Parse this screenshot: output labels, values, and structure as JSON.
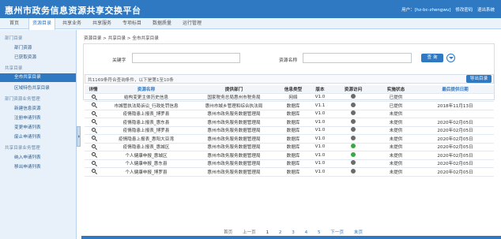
{
  "header": {
    "title": "惠州市政务信息资源共享交换平台",
    "user_label": "用户：[hz-bc-zhengwu]",
    "links": [
      "修改密码",
      "退出系统"
    ]
  },
  "nav": {
    "tabs": [
      "首页",
      "资源目录",
      "共享业务",
      "共享服务",
      "专项标目",
      "数据质量",
      "运行管理"
    ],
    "active_index": 1
  },
  "sidebar": {
    "groups": [
      {
        "title": "部门目录",
        "items": [
          "部门资源",
          "已获取资源"
        ]
      },
      {
        "title": "共享目录",
        "items": [
          "全市共享目录",
          "区域特色共享目录"
        ]
      },
      {
        "title": "部门资源业务管理",
        "items": [
          "新建信息资源",
          "注册申请列表",
          "变更申请列表",
          "废止申请列表"
        ]
      },
      {
        "title": "共享目录业务管理",
        "items": [
          "纳入申请列表",
          "移出申请列表"
        ]
      }
    ],
    "selected": "全市共享目录"
  },
  "content": {
    "breadcrumb": "资源目录 > 共享目录 > 全市共享目录",
    "search": {
      "keyword_label": "关键字",
      "keyword_value": "",
      "resource_label": "资源名称",
      "resource_value": "",
      "query_label": "查 询"
    },
    "count_text": "共1169条符合查询条件，以下是第1至10条",
    "export_label": "导出目录",
    "columns": [
      "详情",
      "资源名称",
      "提供部门",
      "信息类型",
      "版本",
      "资源访问",
      "实施状态",
      "最后提供日期"
    ],
    "rows": [
      {
        "name": "结构变更主体历史信息",
        "dept": "国家税务总局惠州市税务局",
        "type": "网络",
        "ver": "V1.0",
        "access": "gray",
        "status": "已提供",
        "date": ""
      },
      {
        "name": "市城管执法局诉讼_行政处罚信息",
        "dept": "惠州市城乡管理和综合执法局",
        "type": "数据库",
        "ver": "V1.1",
        "access": "gray",
        "status": "已提供",
        "date": "2018年11月13日"
      },
      {
        "name": "疫情隐患上报表_博罗县",
        "dept": "惠州市政务服务数据管理局",
        "type": "数据库",
        "ver": "V1.0",
        "access": "gray",
        "status": "未提供",
        "date": ""
      },
      {
        "name": "疫情隐患上报表_惠东县",
        "dept": "惠州市政务服务数据管理局",
        "type": "数据库",
        "ver": "V1.0",
        "access": "gray",
        "status": "未提供",
        "date": "2020年02月05日"
      },
      {
        "name": "疫情隐患上报表_博罗县",
        "dept": "惠州市政务服务数据管理局",
        "type": "数据库",
        "ver": "V1.0",
        "access": "gray",
        "status": "未提供",
        "date": "2020年02月05日"
      },
      {
        "name": "疫情隐患上报表_惠阳大亚湾",
        "dept": "惠州市政务服务数据管理局",
        "type": "数据库",
        "ver": "V1.0",
        "access": "gray",
        "status": "未提供",
        "date": "2020年02月05日"
      },
      {
        "name": "疫情隐患上报表_惠城区",
        "dept": "惠州市政务服务数据管理局",
        "type": "数据库",
        "ver": "V1.0",
        "access": "green",
        "status": "未提供",
        "date": "2020年02月05日"
      },
      {
        "name": "个人健康申报_惠城区",
        "dept": "惠州市政务服务数据管理局",
        "type": "数据库",
        "ver": "V1.0",
        "access": "green",
        "status": "未提供",
        "date": "2020年02月05日"
      },
      {
        "name": "个人健康申报_惠东县",
        "dept": "惠州市政务服务数据管理局",
        "type": "数据库",
        "ver": "V1.0",
        "access": "gray",
        "status": "未提供",
        "date": "2020年02月05日"
      },
      {
        "name": "个人健康申报_博罗县",
        "dept": "惠州市政务服务数据管理局",
        "type": "数据库",
        "ver": "V1.0",
        "access": "gray",
        "status": "未提供",
        "date": "2020年02月05日"
      }
    ],
    "pager": {
      "first": "首页",
      "prev": "上一页",
      "pages": [
        "1",
        "2",
        "3",
        "4",
        "5"
      ],
      "current": "1",
      "next": "下一页",
      "last": "末页"
    }
  },
  "colors": {
    "brand": "#2f78c2",
    "access_gray": "#6b6b6b",
    "access_green": "#3aa843"
  }
}
